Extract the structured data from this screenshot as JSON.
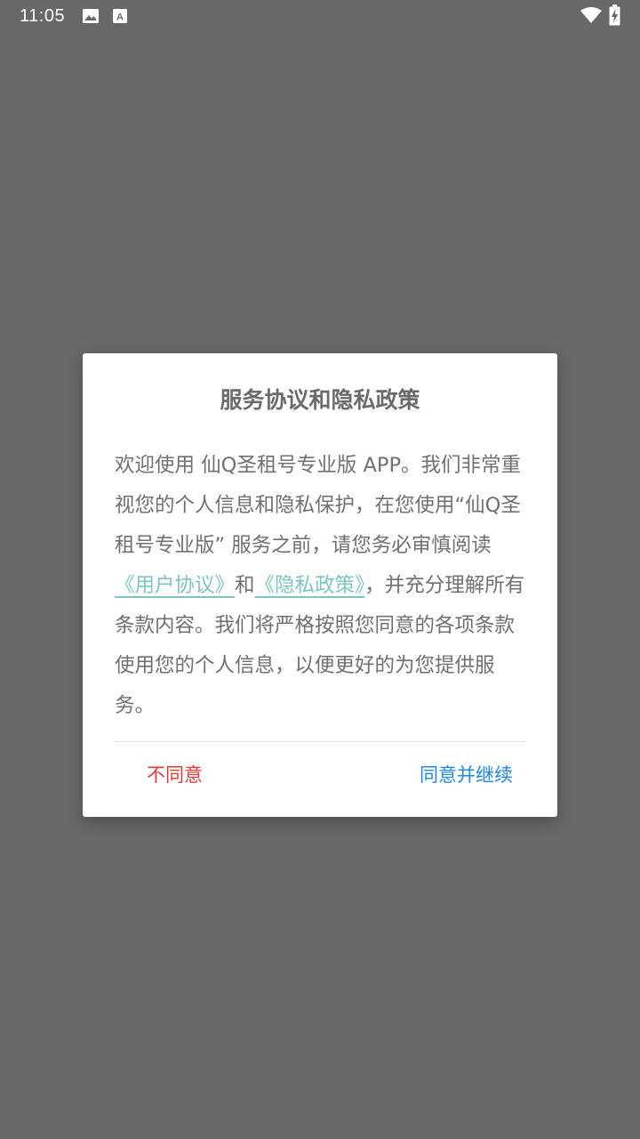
{
  "status_bar": {
    "time": "11:05",
    "icons": [
      "image-icon",
      "text-a-icon",
      "wifi-icon",
      "battery-charging-icon"
    ]
  },
  "dialog": {
    "title": "服务协议和隐私政策",
    "body": {
      "part1": "欢迎使用 仙Q圣租号专业版 APP。我们非常重视您的个人信息和隐私保护，在您使用“仙Q圣租号专业版” 服务之前，请您务必审慎阅读",
      "link_user_agreement": "《用户协议》",
      "connector": "和",
      "link_privacy_policy": "《隐私政策》",
      "part2": "，并充分理解所有条款内容。我们将严格按照您同意的各项条款使用您的个人信息，以便更好的为您提供服务。"
    },
    "buttons": {
      "decline": "不同意",
      "accept": "同意并继续"
    }
  },
  "colors": {
    "overlay": "#686868",
    "link": "#7ec4c2",
    "decline": "#e53935",
    "accept": "#1e88e5",
    "text": "#707070"
  }
}
